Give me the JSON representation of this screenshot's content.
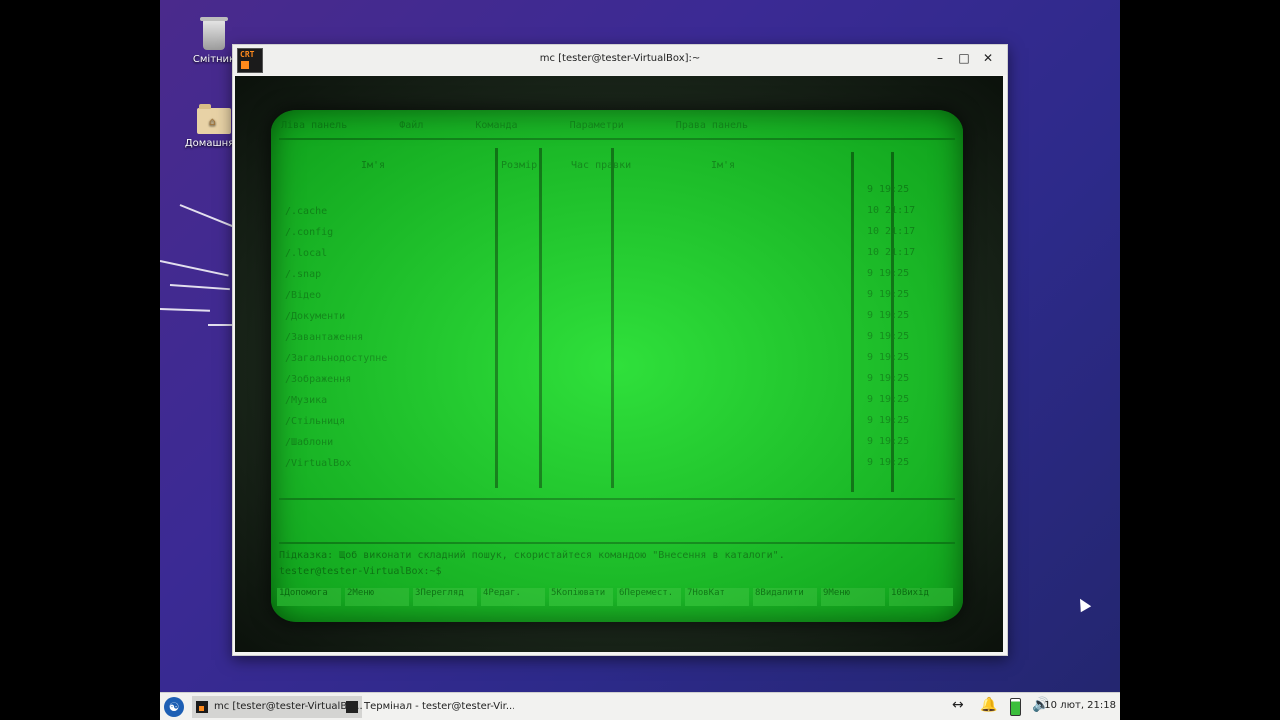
{
  "desktop": {
    "icons": [
      {
        "label": "Смітник",
        "icon": "trash-icon"
      },
      {
        "label": "Домашня т",
        "icon": "home-folder-icon"
      }
    ]
  },
  "window": {
    "title": "mc [tester@tester-VirtualBox]:~",
    "app_icon_text": "CRT",
    "controls": {
      "minimize": "–",
      "maximize": "□",
      "close": "✕"
    }
  },
  "terminal": {
    "menu": [
      "Ліва панель",
      "Файл",
      "Команда",
      "Параметри",
      "Права панель"
    ],
    "left_header": [
      "Ім'я",
      "Розмір",
      "Час правки"
    ],
    "right_header": [
      "Ім'я"
    ],
    "left_files": [
      "/..",
      "/.cache",
      "/.config",
      "/.local",
      "/.snap",
      "/Відео",
      "/Документи",
      "/Завантаження",
      "/Загальнодоступне",
      "/Зображення",
      "/Музика",
      "/Стільниця",
      "/Шаблони",
      "/VirtualBox"
    ],
    "right_dates": [
      "9 19:25",
      "10 21:17",
      "10 21:17",
      "10 21:17",
      "9 19:25",
      "9 19:25",
      "9 19:25",
      "9 19:25",
      "9 19:25",
      "9 19:25",
      "9 19:25",
      "9 19:25",
      "9 19:25",
      "9 19:25"
    ],
    "hint": "Підказка: Щоб виконати складний пошук, скористайтеся командою \"Внесення в каталоги\".",
    "prompt": "tester@tester-VirtualBox:~$",
    "fkeys": [
      "1Допомога",
      "2Меню",
      "3Перегляд",
      "4Редаг.",
      "5Копіювати",
      "6Перемест.",
      "7НовКат",
      "8Видалити",
      "9Меню",
      "10Вихід"
    ]
  },
  "taskbar": {
    "tasks": [
      {
        "label": "mc [tester@tester-VirtualBo...",
        "active": true
      },
      {
        "label": "Термінал - tester@tester-Vir...",
        "active": false
      }
    ],
    "clock": "10 лют, 21:18"
  }
}
